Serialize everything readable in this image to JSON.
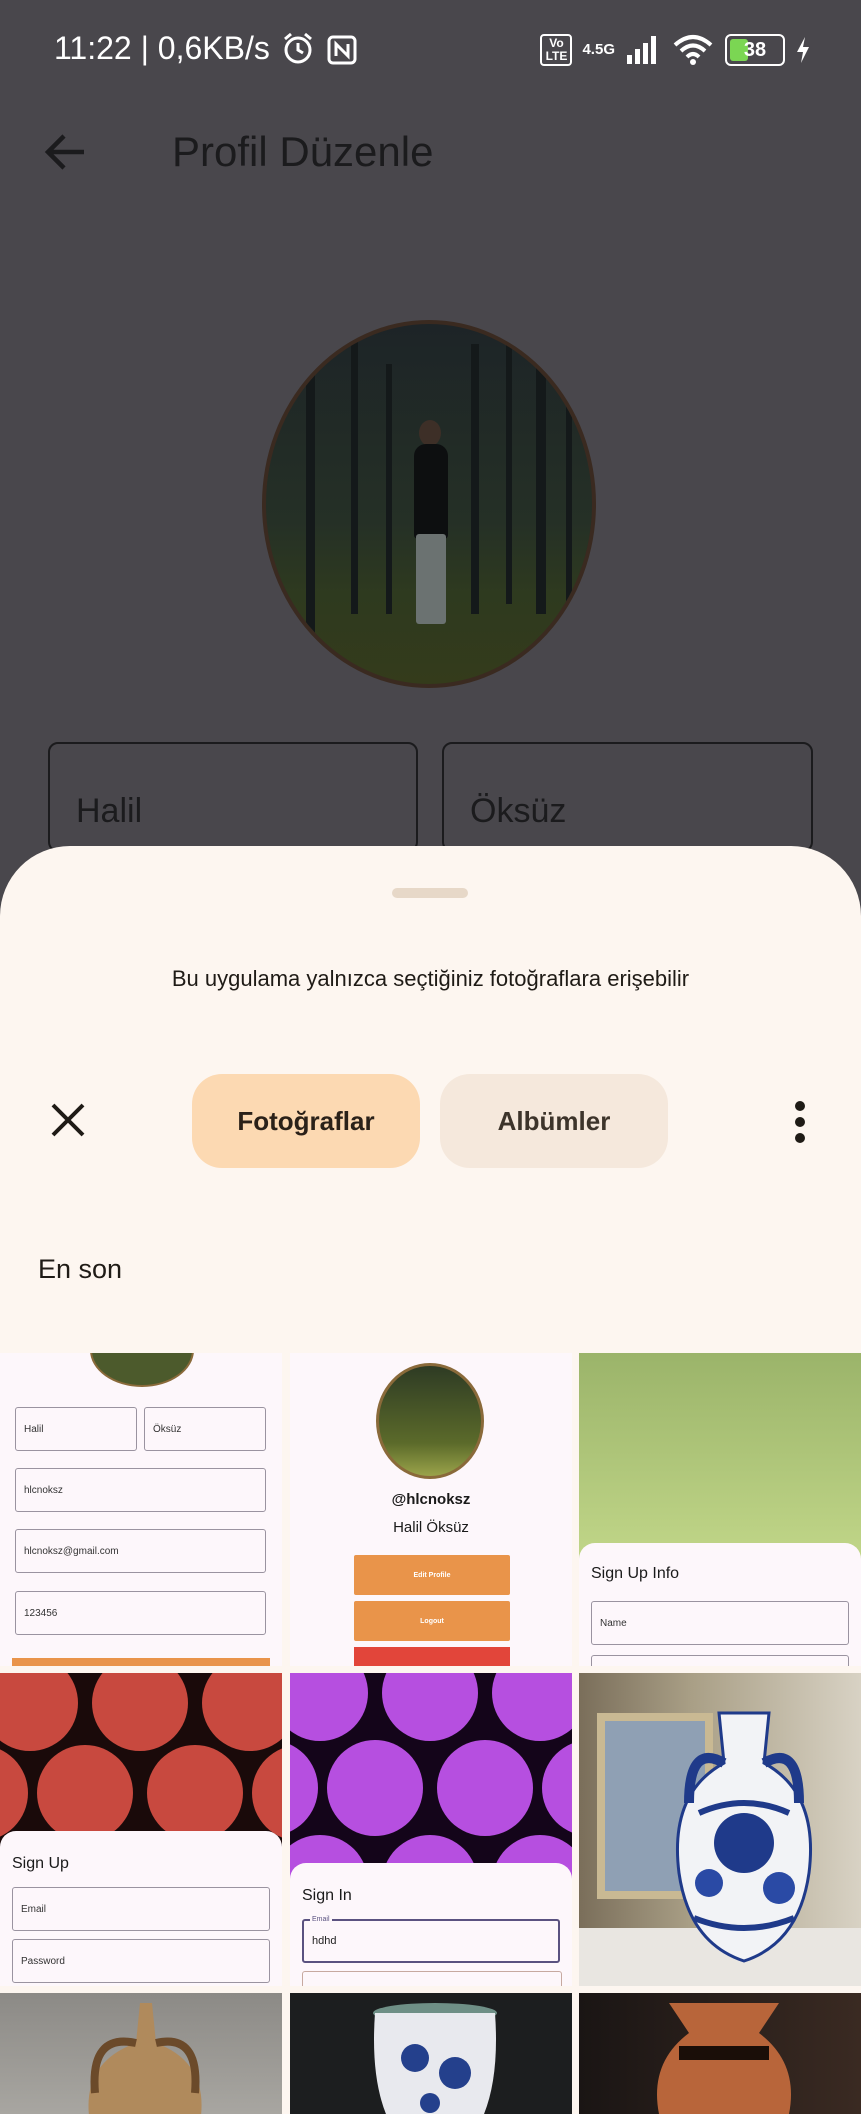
{
  "status_bar": {
    "time": "11:22 | 0,6KB/s",
    "volte": "Vo\nLTE",
    "network": "4.5G",
    "battery": "38"
  },
  "app_bar": {
    "title": "Profil Düzenle"
  },
  "form": {
    "first_name": "Halil",
    "last_name": "Öksüz"
  },
  "picker": {
    "notice": "Bu uygulama yalnızca seçtiğiniz fotoğraflara erişebilir",
    "tabs": [
      {
        "label": "Fotoğraflar",
        "active": true
      },
      {
        "label": "Albümler",
        "active": false
      }
    ],
    "section_title": "En son"
  },
  "thumbnails": {
    "t1": {
      "first": "Halil",
      "last": "Öksüz",
      "username": "hlcnoksz",
      "email": "hlcnoksz@gmail.com",
      "password": "123456"
    },
    "t2": {
      "handle": "@hlcnoksz",
      "name": "Halil Öksüz",
      "edit": "Edit Profile",
      "logout": "Logout"
    },
    "t3": {
      "title": "Sign Up Info",
      "name_placeholder": "Name"
    },
    "t4": {
      "title": "Sign Up",
      "email": "Email",
      "password": "Password"
    },
    "t5": {
      "title": "Sign In",
      "email_label": "Email",
      "email_value": "hdhd"
    }
  },
  "colors": {
    "sheet": "#fdf6f0",
    "chip_active": "#fcd9b2",
    "chip_inactive": "#f5e8dc",
    "scrim": "#49474c",
    "accent_orange": "#e9944a"
  }
}
